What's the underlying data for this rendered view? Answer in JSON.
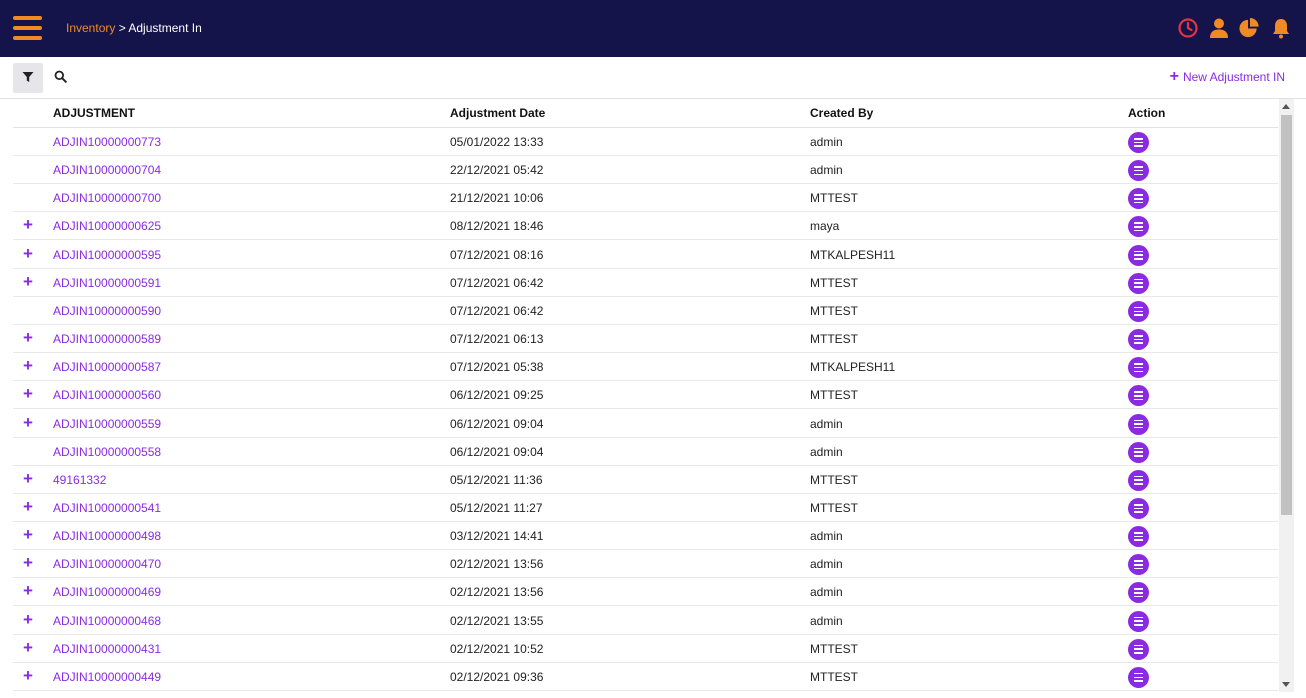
{
  "header": {
    "breadcrumb_root": "Inventory",
    "breadcrumb_sep": " > ",
    "breadcrumb_current": "Adjustment In"
  },
  "icons": {
    "menu": "hamburger-icon",
    "clock": "clock-icon",
    "user": "user-icon",
    "chart": "pie-chart-icon",
    "bell": "bell-icon",
    "filter": "filter-icon",
    "search": "search-icon"
  },
  "colors": {
    "topbar": "#14144a",
    "accent_orange": "#f08a24",
    "accent_purple": "#8a2be2",
    "clock_red": "#e03545"
  },
  "toolbar": {
    "new_label": "New Adjustment IN",
    "new_icon": "+"
  },
  "table": {
    "columns": [
      "ADJUSTMENT",
      "Adjustment Date",
      "Created By",
      "Action"
    ],
    "rows": [
      {
        "expand": "",
        "adjustment": "ADJIN10000000773",
        "date": "05/01/2022 13:33",
        "created_by": "admin"
      },
      {
        "expand": "",
        "adjustment": "ADJIN10000000704",
        "date": "22/12/2021 05:42",
        "created_by": "admin"
      },
      {
        "expand": "",
        "adjustment": "ADJIN10000000700",
        "date": "21/12/2021 10:06",
        "created_by": "MTTEST"
      },
      {
        "expand": "+",
        "adjustment": "ADJIN10000000625",
        "date": "08/12/2021 18:46",
        "created_by": "maya"
      },
      {
        "expand": "+",
        "adjustment": "ADJIN10000000595",
        "date": "07/12/2021 08:16",
        "created_by": "MTKALPESH11"
      },
      {
        "expand": "+",
        "adjustment": "ADJIN10000000591",
        "date": "07/12/2021 06:42",
        "created_by": "MTTEST"
      },
      {
        "expand": "",
        "adjustment": "ADJIN10000000590",
        "date": "07/12/2021 06:42",
        "created_by": "MTTEST"
      },
      {
        "expand": "+",
        "adjustment": "ADJIN10000000589",
        "date": "07/12/2021 06:13",
        "created_by": "MTTEST"
      },
      {
        "expand": "+",
        "adjustment": "ADJIN10000000587",
        "date": "07/12/2021 05:38",
        "created_by": "MTKALPESH11"
      },
      {
        "expand": "+",
        "adjustment": "ADJIN10000000560",
        "date": "06/12/2021 09:25",
        "created_by": "MTTEST"
      },
      {
        "expand": "+",
        "adjustment": "ADJIN10000000559",
        "date": "06/12/2021 09:04",
        "created_by": "admin"
      },
      {
        "expand": "",
        "adjustment": "ADJIN10000000558",
        "date": "06/12/2021 09:04",
        "created_by": "admin"
      },
      {
        "expand": "+",
        "adjustment": "49161332",
        "date": "05/12/2021 11:36",
        "created_by": "MTTEST"
      },
      {
        "expand": "+",
        "adjustment": "ADJIN10000000541",
        "date": "05/12/2021 11:27",
        "created_by": "MTTEST"
      },
      {
        "expand": "+",
        "adjustment": "ADJIN10000000498",
        "date": "03/12/2021 14:41",
        "created_by": "admin"
      },
      {
        "expand": "+",
        "adjustment": "ADJIN10000000470",
        "date": "02/12/2021 13:56",
        "created_by": "admin"
      },
      {
        "expand": "+",
        "adjustment": "ADJIN10000000469",
        "date": "02/12/2021 13:56",
        "created_by": "admin"
      },
      {
        "expand": "+",
        "adjustment": "ADJIN10000000468",
        "date": "02/12/2021 13:55",
        "created_by": "admin"
      },
      {
        "expand": "+",
        "adjustment": "ADJIN10000000431",
        "date": "02/12/2021 10:52",
        "created_by": "MTTEST"
      },
      {
        "expand": "+",
        "adjustment": "ADJIN10000000449",
        "date": "02/12/2021 09:36",
        "created_by": "MTTEST"
      }
    ]
  }
}
